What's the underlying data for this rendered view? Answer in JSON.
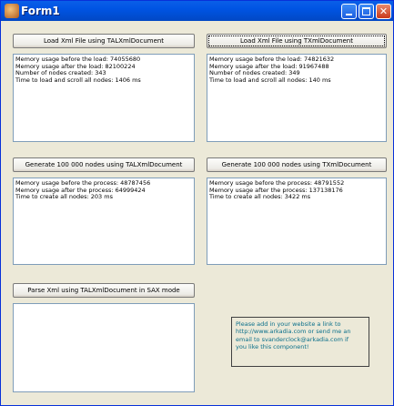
{
  "window": {
    "title": "Form1"
  },
  "buttons": {
    "load_alx": "Load Xml File using TALXmlDocument",
    "load_txml": "Load Xml File using TXmlDocument",
    "gen_alx": "Generate 100 000 nodes using TALXmlDocument",
    "gen_txml": "Generate 100 000 nodes using TXmlDocument",
    "parse_sax": "Parse Xml using TALXmlDocument in SAX mode"
  },
  "memos": {
    "load_alx": [
      "Memory usage before the load: 74055680",
      "Memory usage after the load: 82100224",
      "Number of nodes created: 343",
      "Time to load and scroll all nodes: 1406 ms"
    ],
    "load_txml": [
      "Memory usage before the load: 74821632",
      "Memory usage after the load: 91967488",
      "Number of nodes created: 349",
      "Time to load and scroll all nodes: 140 ms"
    ],
    "gen_alx": [
      "Memory usage before the process: 48787456",
      "Memory usage after the process: 64999424",
      "Time to create all nodes: 203 ms"
    ],
    "gen_txml": [
      "Memory usage before the process: 48791552",
      "Memory usage after the process: 137138176",
      "Time to create all nodes: 3422 ms"
    ],
    "sax": []
  },
  "note": [
    "Please add in your website a link to",
    "http://www.arkadia.com or send me an",
    "email to svanderclock@arkadia.com if",
    "you like this component!"
  ]
}
